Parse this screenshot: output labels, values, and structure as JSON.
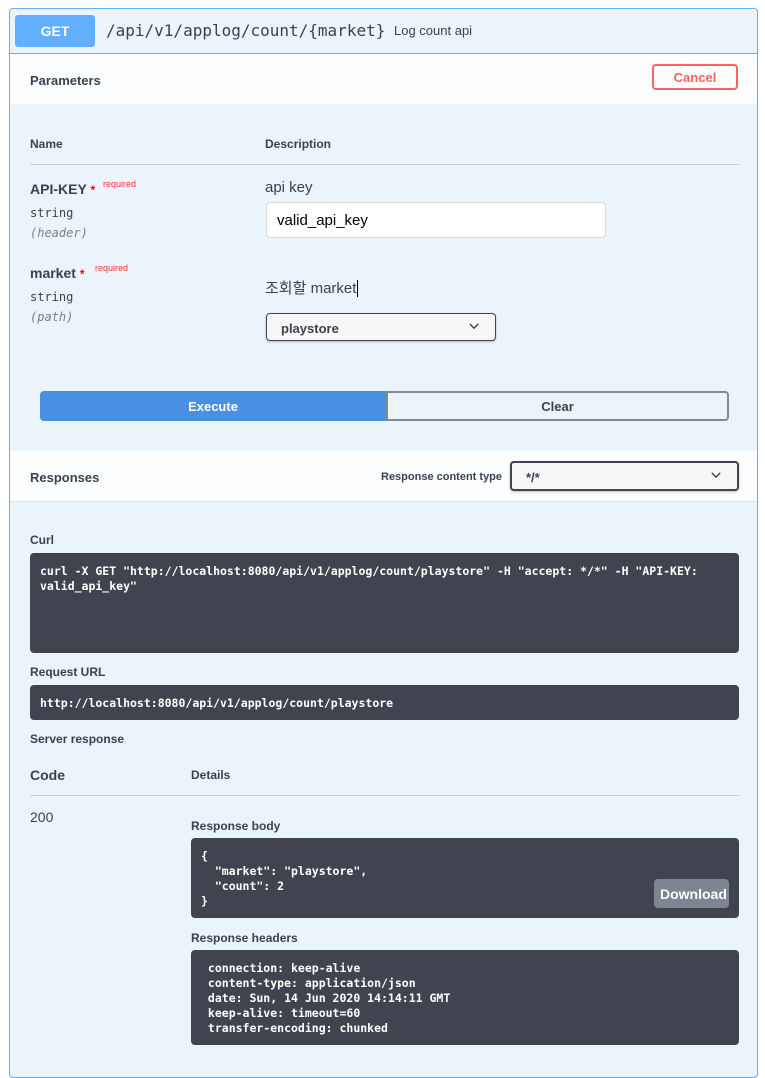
{
  "summary": {
    "method": "GET",
    "path": "/api/v1/applog/count/{market}",
    "description": "Log count api"
  },
  "parameters": {
    "title": "Parameters",
    "cancel_label": "Cancel",
    "col_name": "Name",
    "col_description": "Description",
    "items": [
      {
        "name": "API-KEY",
        "star": "*",
        "required": "required",
        "type": "string",
        "in": "(header)",
        "description": "api key",
        "value": "valid_api_key"
      },
      {
        "name": "market",
        "star": "*",
        "required": "required",
        "type": "string",
        "in": "(path)",
        "description": "조회할 market",
        "selected": "playstore"
      }
    ]
  },
  "actions": {
    "execute_label": "Execute",
    "clear_label": "Clear"
  },
  "responses": {
    "title": "Responses",
    "content_type_label": "Response content type",
    "content_type_value": "*/*"
  },
  "curl": {
    "label": "Curl",
    "command": "curl -X GET \"http://localhost:8080/api/v1/applog/count/playstore\" -H \"accept: */*\" -H \"API-KEY:\nvalid_api_key\""
  },
  "request_url": {
    "label": "Request URL",
    "value": "http://localhost:8080/api/v1/applog/count/playstore"
  },
  "server_response": {
    "label": "Server response",
    "col_code": "Code",
    "col_details": "Details",
    "code": "200",
    "body_label": "Response body",
    "body": "{\n  \"market\": \"playstore\",\n  \"count\": 2\n}",
    "download_label": "Download",
    "headers_label": "Response headers",
    "headers": " connection: keep-alive \n content-type: application/json \n date: Sun, 14 Jun 2020 14:14:11 GMT \n keep-alive: timeout=60 \n transfer-encoding: chunked "
  }
}
